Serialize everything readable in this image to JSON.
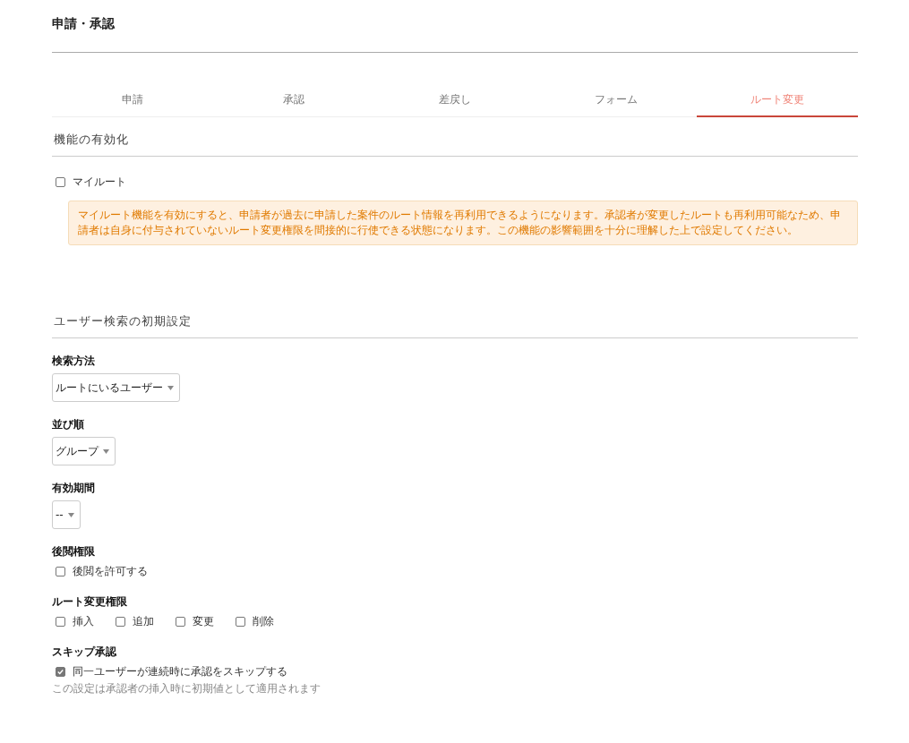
{
  "page_title": "申請・承認",
  "tabs": [
    {
      "label": "申請",
      "selected": false
    },
    {
      "label": "承認",
      "selected": false
    },
    {
      "label": "差戻し",
      "selected": false
    },
    {
      "label": "フォーム",
      "selected": false
    },
    {
      "label": "ルート変更",
      "selected": true
    }
  ],
  "feature_section": {
    "heading": "機能の有効化",
    "my_route": {
      "label": "マイルート",
      "checked": false
    },
    "warning": "マイルート機能を有効にすると、申請者が過去に申請した案件のルート情報を再利用できるようになります。承認者が変更したルートも再利用可能なため、申請者は自身に付与されていないルート変更権限を間接的に行使できる状態になります。この機能の影響範囲を十分に理解した上で設定してください。"
  },
  "user_search_section": {
    "heading": "ユーザー検索の初期設定",
    "fields": [
      {
        "kind": "select",
        "label": "検索方法",
        "value": "ルートにいるユーザー"
      },
      {
        "kind": "select",
        "label": "並び順",
        "value": "グループ"
      },
      {
        "kind": "select",
        "label": "有効期間",
        "value": "--"
      },
      {
        "kind": "checkboxes",
        "label": "後閲権限",
        "options": [
          {
            "label": "後閲を許可する",
            "checked": false
          }
        ]
      },
      {
        "kind": "checkboxes",
        "label": "ルート変更権限",
        "options": [
          {
            "label": "挿入",
            "checked": false
          },
          {
            "label": "追加",
            "checked": false
          },
          {
            "label": "変更",
            "checked": false
          },
          {
            "label": "削除",
            "checked": false
          }
        ]
      },
      {
        "kind": "checkboxes",
        "label": "スキップ承認",
        "options": [
          {
            "label": "同一ユーザーが連続時に承認をスキップする",
            "checked": true
          }
        ],
        "hint": "この設定は承認者の挿入時に初期値として適用されます"
      }
    ]
  }
}
